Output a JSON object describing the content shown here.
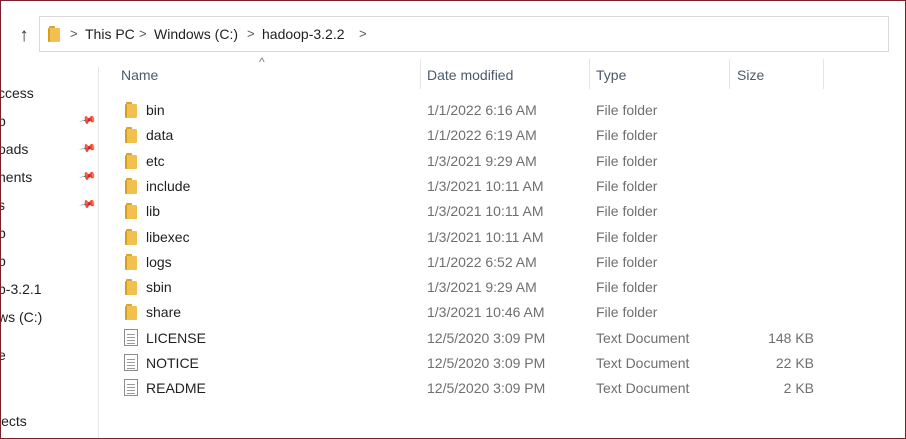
{
  "address": {
    "crumbs": [
      "This PC",
      "Windows (C:)",
      "hadoop-3.2.2"
    ],
    "separator": ">"
  },
  "nav": {
    "items": [
      {
        "label": "ccess",
        "pinned": false
      },
      {
        "label": "p",
        "pinned": true
      },
      {
        "label": "oads",
        "pinned": true
      },
      {
        "label": "nents",
        "pinned": true
      },
      {
        "label": "s",
        "pinned": true
      },
      {
        "label": "p",
        "pinned": false
      },
      {
        "label": "p",
        "pinned": false
      },
      {
        "label": "p-3.2.1",
        "pinned": false
      },
      {
        "label": "ws (C:)",
        "pinned": false
      },
      {
        "label": "e",
        "pinned": false
      },
      {
        "label": "jects",
        "pinned": false
      }
    ]
  },
  "columns": {
    "name": "Name",
    "date": "Date modified",
    "type": "Type",
    "size": "Size"
  },
  "files": [
    {
      "name": "bin",
      "date": "1/1/2022 6:16 AM",
      "type": "File folder",
      "size": "",
      "icon": "folder-icon"
    },
    {
      "name": "data",
      "date": "1/1/2022 6:19 AM",
      "type": "File folder",
      "size": "",
      "icon": "folder-icon"
    },
    {
      "name": "etc",
      "date": "1/3/2021 9:29 AM",
      "type": "File folder",
      "size": "",
      "icon": "folder-icon"
    },
    {
      "name": "include",
      "date": "1/3/2021 10:11 AM",
      "type": "File folder",
      "size": "",
      "icon": "folder-icon"
    },
    {
      "name": "lib",
      "date": "1/3/2021 10:11 AM",
      "type": "File folder",
      "size": "",
      "icon": "folder-icon"
    },
    {
      "name": "libexec",
      "date": "1/3/2021 10:11 AM",
      "type": "File folder",
      "size": "",
      "icon": "folder-icon"
    },
    {
      "name": "logs",
      "date": "1/1/2022 6:52 AM",
      "type": "File folder",
      "size": "",
      "icon": "folder-icon"
    },
    {
      "name": "sbin",
      "date": "1/3/2021 9:29 AM",
      "type": "File folder",
      "size": "",
      "icon": "folder-icon"
    },
    {
      "name": "share",
      "date": "1/3/2021 10:46 AM",
      "type": "File folder",
      "size": "",
      "icon": "folder-icon"
    },
    {
      "name": "LICENSE",
      "date": "12/5/2020 3:09 PM",
      "type": "Text Document",
      "size": "148 KB",
      "icon": "text-document-icon"
    },
    {
      "name": "NOTICE",
      "date": "12/5/2020 3:09 PM",
      "type": "Text Document",
      "size": "22 KB",
      "icon": "text-document-icon"
    },
    {
      "name": "README",
      "date": "12/5/2020 3:09 PM",
      "type": "Text Document",
      "size": "2 KB",
      "icon": "text-document-icon"
    }
  ]
}
